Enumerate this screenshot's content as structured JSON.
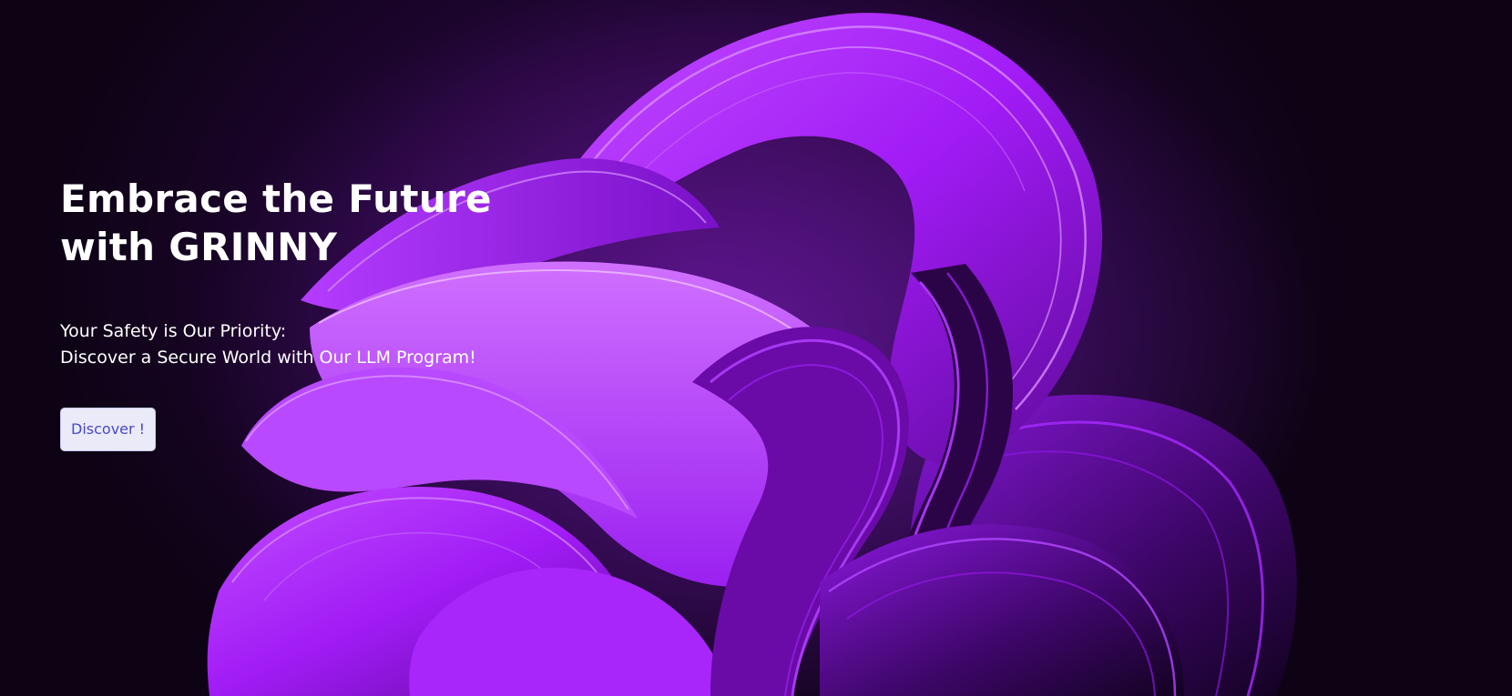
{
  "hero": {
    "title_line1": "Embrace the Future",
    "title_line2": "with GRINNY",
    "subtitle_line1": "Your Safety is Our Priority:",
    "subtitle_line2": "Discover a Secure World with Our LLM Program!",
    "cta_label": "Discover !"
  },
  "colors": {
    "background": "#0d0312",
    "accent_purple": "#a21cff",
    "button_bg": "#eaeaf8",
    "button_text": "#4b48c8"
  }
}
